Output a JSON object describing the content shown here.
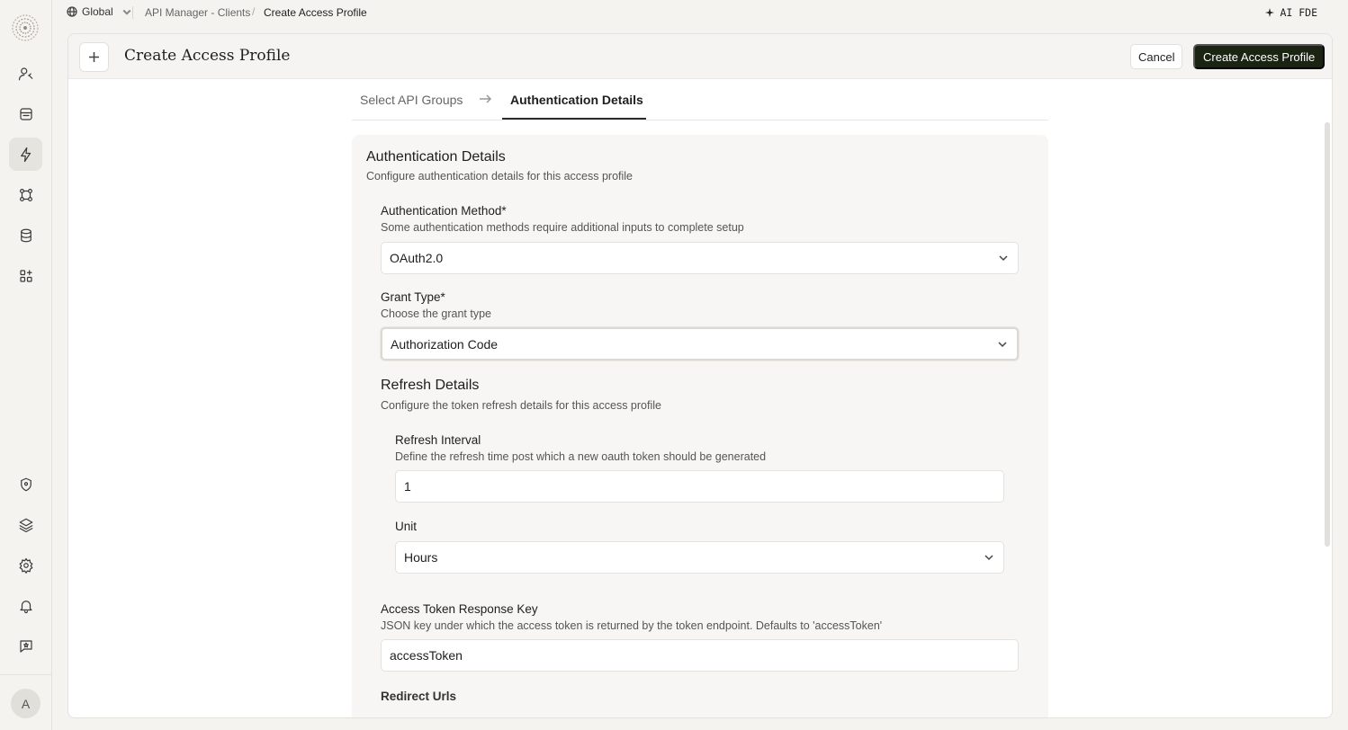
{
  "topbar": {
    "scope": "Global",
    "breadcrumb_parent": "API Manager - Clients",
    "breadcrumb_separator": "/",
    "breadcrumb_current": "Create Access Profile",
    "ai_label": "AI FDE"
  },
  "sidebar": {
    "avatar_initial": "A"
  },
  "header": {
    "title": "Create Access Profile",
    "cancel_label": "Cancel",
    "create_label": "Create Access Profile"
  },
  "tabs": {
    "step1": "Select API Groups",
    "step2": "Authentication Details"
  },
  "auth": {
    "title": "Authentication Details",
    "subtitle": "Configure authentication details for this access profile",
    "method_label": "Authentication Method*",
    "method_help": "Some authentication methods require additional inputs to complete setup",
    "method_value": "OAuth2.0",
    "grant_label": "Grant Type*",
    "grant_help": "Choose the grant type",
    "grant_value": "Authorization Code"
  },
  "refresh": {
    "title": "Refresh Details",
    "subtitle": "Configure the token refresh details for this access profile",
    "interval_label": "Refresh Interval",
    "interval_help": "Define the refresh time post which a new oauth token should be generated",
    "interval_value": "1",
    "unit_label": "Unit",
    "unit_value": "Hours"
  },
  "token": {
    "label": "Access Token Response Key",
    "help": "JSON key under which the access token is returned by the token endpoint. Defaults to 'accessToken'",
    "value": "accessToken"
  },
  "redirect": {
    "label": "Redirect Urls"
  }
}
